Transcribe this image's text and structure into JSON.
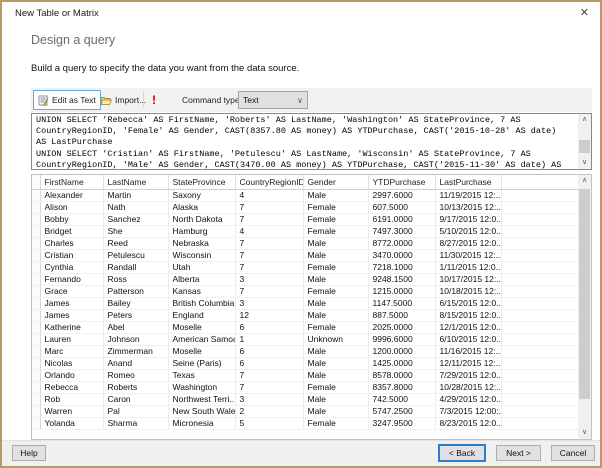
{
  "window": {
    "title": "New Table or Matrix",
    "close_glyph": "✕"
  },
  "header": {
    "title": "Design a query",
    "description": "Build a query to specify the data you want from the data source."
  },
  "toolbar": {
    "edit_as_text_label": "Edit as Text",
    "import_label": "Import...",
    "run_glyph": "!",
    "command_type_label": "Command type:",
    "command_type_value": "Text",
    "chevron_glyph": "∨"
  },
  "query": {
    "lines": [
      "UNION SELECT 'Rebecca' AS FirstName, 'Roberts' AS LastName, 'Washington' AS StateProvince, 7 AS",
      "CountryRegionID, 'Female' AS Gender, CAST(8357.80 AS money) AS YTDPurchase, CAST('2015-10-28' AS date)",
      "AS LastPurchase",
      "UNION SELECT 'Cristian' AS FirstName, 'Petulescu' AS LastName, 'Wisconsin' AS StateProvince, 7 AS",
      "CountryRegionID, 'Male' AS Gender, CAST(3470.00 AS money) AS YTDPurchase, CAST('2015-11-30' AS date) AS"
    ]
  },
  "grid": {
    "columns": [
      "FirstName",
      "LastName",
      "StateProvince",
      "CountryRegionID",
      "Gender",
      "YTDPurchase",
      "LastPurchase"
    ],
    "rows": [
      [
        "Alexander",
        "Martin",
        "Saxony",
        "4",
        "Male",
        "2997.6000",
        "11/19/2015 12:..."
      ],
      [
        "Alison",
        "Nath",
        "Alaska",
        "7",
        "Female",
        "607.5000",
        "10/13/2015 12:..."
      ],
      [
        "Bobby",
        "Sanchez",
        "North Dakota",
        "7",
        "Female",
        "6191.0000",
        "9/17/2015 12:0..."
      ],
      [
        "Bridget",
        "She",
        "Hamburg",
        "4",
        "Female",
        "7497.3000",
        "5/10/2015 12:0..."
      ],
      [
        "Charles",
        "Reed",
        "Nebraska",
        "7",
        "Male",
        "8772.0000",
        "8/27/2015 12:0..."
      ],
      [
        "Cristian",
        "Petulescu",
        "Wisconsin",
        "7",
        "Male",
        "3470.0000",
        "11/30/2015 12:..."
      ],
      [
        "Cynthia",
        "Randall",
        "Utah",
        "7",
        "Female",
        "7218.1000",
        "1/11/2015 12:0..."
      ],
      [
        "Fernando",
        "Ross",
        "Alberta",
        "3",
        "Male",
        "9248.1500",
        "10/17/2015 12:..."
      ],
      [
        "Grace",
        "Patterson",
        "Kansas",
        "7",
        "Female",
        "1215.0000",
        "10/18/2015 12:..."
      ],
      [
        "James",
        "Bailey",
        "British Columbia",
        "3",
        "Male",
        "1147.5000",
        "6/15/2015 12:0..."
      ],
      [
        "James",
        "Peters",
        "England",
        "12",
        "Male",
        "887.5000",
        "8/15/2015 12:0..."
      ],
      [
        "Katherine",
        "Abel",
        "Moselle",
        "6",
        "Female",
        "2025.0000",
        "12/1/2015 12:0..."
      ],
      [
        "Lauren",
        "Johnson",
        "American Samoa",
        "1",
        "Unknown",
        "9996.6000",
        "6/10/2015 12:0..."
      ],
      [
        "Marc",
        "Zimmerman",
        "Moselle",
        "6",
        "Male",
        "1200.0000",
        "11/16/2015 12:..."
      ],
      [
        "Nicolas",
        "Anand",
        "Seine (Paris)",
        "6",
        "Male",
        "1425.0000",
        "12/11/2015 12:..."
      ],
      [
        "Orlando",
        "Romeo",
        "Texas",
        "7",
        "Male",
        "8578.0000",
        "7/29/2015 12:0..."
      ],
      [
        "Rebecca",
        "Roberts",
        "Washington",
        "7",
        "Female",
        "8357.8000",
        "10/28/2015 12:..."
      ],
      [
        "Rob",
        "Caron",
        "Northwest Terri...",
        "3",
        "Male",
        "742.5000",
        "4/29/2015 12:0..."
      ],
      [
        "Warren",
        "Pal",
        "New South Wales",
        "2",
        "Male",
        "5747.2500",
        "7/3/2015 12:00:..."
      ],
      [
        "Yolanda",
        "Sharma",
        "Micronesia",
        "5",
        "Female",
        "3247.9500",
        "8/23/2015 12:0..."
      ]
    ]
  },
  "scrollbars": {
    "up_glyph": "∧",
    "down_glyph": "∨"
  },
  "footer": {
    "help_label": "Help",
    "back_label": "< Back",
    "next_label": "Next >",
    "cancel_label": "Cancel"
  },
  "colors": {
    "dialog_border": "#b89a62",
    "focus_accent": "#2e7ccc",
    "run_icon_red": "#c00000",
    "toolbar_bg": "#f1f1f1"
  }
}
